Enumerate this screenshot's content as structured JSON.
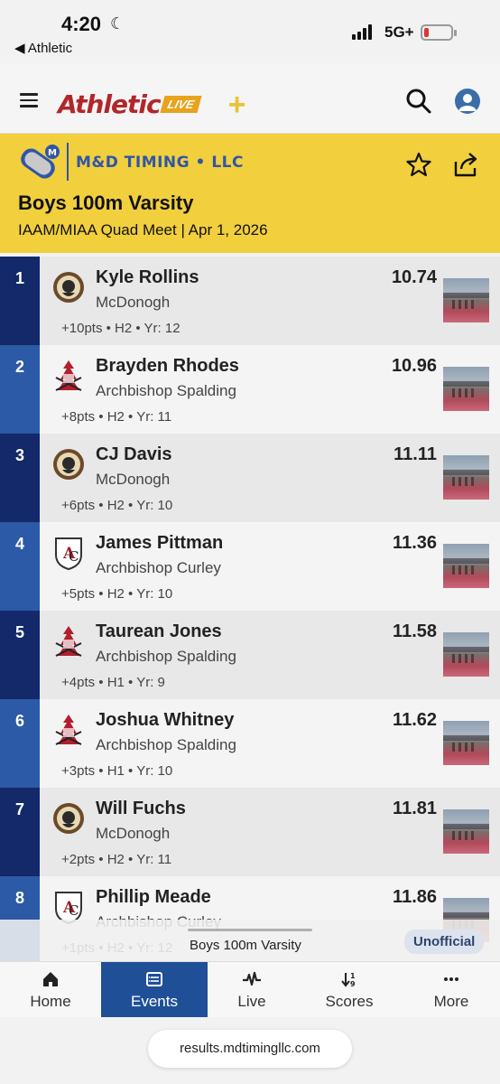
{
  "status_bar": {
    "time": "4:20",
    "back_app": "Athletic",
    "network": "5G+",
    "battery_level": 0.1
  },
  "header": {
    "brand": "Athletic",
    "brand_live": "LIVE"
  },
  "banner": {
    "company": "M&D TIMING • LLC",
    "event_title": "Boys 100m Varsity",
    "meet_info": "IAAM/MIAA Quad Meet | Apr 1, 2026"
  },
  "results": [
    {
      "place": "1",
      "name": "Kyle Rollins",
      "school": "McDonogh",
      "meta": "+10pts • H2 • Yr: 12",
      "time": "10.74",
      "logo": "mcdonogh"
    },
    {
      "place": "2",
      "name": "Brayden Rhodes",
      "school": "Archbishop Spalding",
      "meta": "+8pts • H2 • Yr: 11",
      "time": "10.96",
      "logo": "spalding"
    },
    {
      "place": "3",
      "name": "CJ Davis",
      "school": "McDonogh",
      "meta": "+6pts • H2 • Yr: 10",
      "time": "11.11",
      "logo": "mcdonogh"
    },
    {
      "place": "4",
      "name": "James Pittman",
      "school": "Archbishop Curley",
      "meta": "+5pts • H2 • Yr: 10",
      "time": "11.36",
      "logo": "curley"
    },
    {
      "place": "5",
      "name": "Taurean Jones",
      "school": "Archbishop Spalding",
      "meta": "+4pts • H1 • Yr: 9",
      "time": "11.58",
      "logo": "spalding"
    },
    {
      "place": "6",
      "name": "Joshua Whitney",
      "school": "Archbishop Spalding",
      "meta": "+3pts • H1 • Yr: 10",
      "time": "11.62",
      "logo": "spalding"
    },
    {
      "place": "7",
      "name": "Will Fuchs",
      "school": "McDonogh",
      "meta": "+2pts • H2 • Yr: 11",
      "time": "11.81",
      "logo": "mcdonogh"
    },
    {
      "place": "8",
      "name": "Phillip Meade",
      "school": "Archbishop Curley",
      "meta": "+1pts • H2 • Yr: 12",
      "time": "11.86",
      "logo": "curley"
    }
  ],
  "overlay": {
    "event": "Boys 100m Varsity",
    "status": "Unofficial"
  },
  "nav": [
    {
      "label": "Home",
      "icon": "home-icon"
    },
    {
      "label": "Events",
      "icon": "list-icon",
      "active": true
    },
    {
      "label": "Live",
      "icon": "pulse-icon"
    },
    {
      "label": "Scores",
      "icon": "sort-icon"
    },
    {
      "label": "More",
      "icon": "more-icon"
    }
  ],
  "url": "results.mdtimingllc.com",
  "colors": {
    "banner": "#f1cf3d",
    "place_dark": "#13296a",
    "place_light": "#2c5aa6",
    "nav_active": "#1f4f97",
    "brand_red": "#b2262a",
    "company_blue": "#2f56a8"
  }
}
